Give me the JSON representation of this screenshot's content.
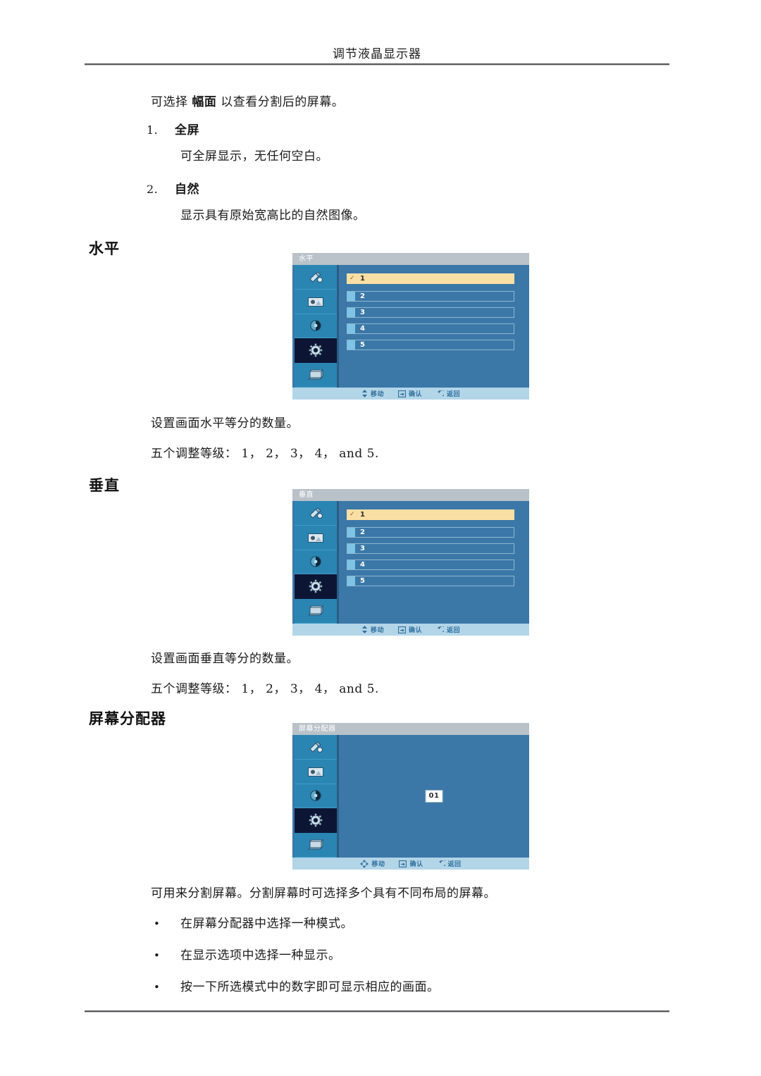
{
  "header": {
    "running_title": "调节液晶显示器"
  },
  "intro": {
    "before": "可选择 ",
    "emphasis": "幅面",
    "after": " 以查看分割后的屏幕。"
  },
  "numbered_list": [
    {
      "marker": "1.",
      "title": "全屏",
      "body": "可全屏显示，无任何空白。"
    },
    {
      "marker": "2.",
      "title": "自然",
      "body": "显示具有原始宽高比的自然图像。"
    }
  ],
  "sections": [
    {
      "heading": "水平",
      "caption_lines": [
        "设置画面水平等分的数量。",
        "五个调整等级： 1， 2， 3， 4， and 5."
      ],
      "osd": {
        "title": "水平",
        "options": [
          {
            "label": "1",
            "selected": true,
            "check": "✓"
          },
          {
            "label": "2",
            "selected": false,
            "check": ""
          },
          {
            "label": "3",
            "selected": false,
            "check": ""
          },
          {
            "label": "4",
            "selected": false,
            "check": ""
          },
          {
            "label": "5",
            "selected": false,
            "check": ""
          }
        ]
      }
    },
    {
      "heading": "垂直",
      "caption_lines": [
        "设置画面垂直等分的数量。",
        "五个调整等级： 1， 2， 3， 4， and 5."
      ],
      "osd": {
        "title": "垂直",
        "options": [
          {
            "label": "1",
            "selected": true,
            "check": "✓"
          },
          {
            "label": "2",
            "selected": false,
            "check": ""
          },
          {
            "label": "3",
            "selected": false,
            "check": ""
          },
          {
            "label": "4",
            "selected": false,
            "check": ""
          },
          {
            "label": "5",
            "selected": false,
            "check": ""
          }
        ]
      }
    },
    {
      "heading": "屏幕分配器",
      "caption_lines": [
        "可用来分割屏幕。分割屏幕时可选择多个具有不同布局的屏幕。"
      ],
      "bullets": [
        {
          "dot": "•",
          "text": "在屏幕分配器中选择一种模式。"
        },
        {
          "dot": "•",
          "text": "在显示选项中选择一种显示。"
        },
        {
          "dot": "•",
          "text": "按一下所选模式中的数字即可显示相应的画面。"
        }
      ],
      "osd": {
        "title": "屏幕分配器",
        "badge": "01"
      }
    }
  ],
  "osd_common": {
    "sidebar_icons": [
      {
        "name": "picture-brush-icon",
        "selected": false
      },
      {
        "name": "monitor-picture-icon",
        "selected": false
      },
      {
        "name": "sound-icon",
        "selected": false
      },
      {
        "name": "gear-setup-icon",
        "selected": true
      },
      {
        "name": "multi-control-icon",
        "selected": false
      }
    ],
    "footer": {
      "move": "移动",
      "enter": "确认",
      "return": "返回"
    }
  },
  "colors": {
    "osd_body": "#3b78a8",
    "osd_titlebar": "#b9c2c9",
    "osd_sidebar": "#2b85b3",
    "osd_selected_tab": "#0d1535",
    "osd_footer": "#b3d5e8",
    "highlight_row": "#fadfa4",
    "chip": "#7ec4e4",
    "rule": "#58595b"
  }
}
